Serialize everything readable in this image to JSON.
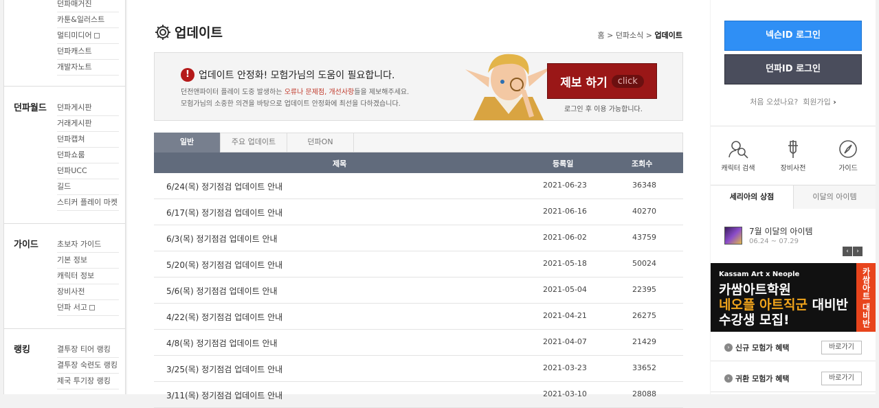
{
  "left_nav": {
    "top_items": [
      "던파매거진",
      "카툰&일러스트",
      "멀티미디어",
      "던파캐스트",
      "개발자노트"
    ],
    "sections": [
      {
        "title": "던파월드",
        "items": [
          "던파게시판",
          "거래게시판",
          "던파캡쳐",
          "던파쇼룸",
          "던파UCC",
          "길드",
          "스티커 플레이 마켓"
        ]
      },
      {
        "title": "가이드",
        "items": [
          "초보자 가이드",
          "기본 정보",
          "캐릭터 정보",
          "장비사전",
          "던파 서고"
        ]
      },
      {
        "title": "랭킹",
        "items": [
          "결투장 티어 랭킹",
          "결투장 숙련도 랭킹",
          "제국 투기장 랭킹"
        ]
      }
    ]
  },
  "page": {
    "title": "업데이트",
    "breadcrumb": {
      "home": "홈",
      "sep": ">",
      "section": "던파소식",
      "current": "업데이트"
    }
  },
  "banner": {
    "alert_icon": "!",
    "headline": "업데이트 안정화! 모험가님의 도움이 필요합니다.",
    "line1_pre": "던전앤파이터 플레이 도중 발생하는 ",
    "line1_red": "오류나 문제점, 개선사항",
    "line1_post": "들을 제보해주세요.",
    "line2": "모험가님의 소중한 의견을 바탕으로 업데이트 안정화에 최선을 다하겠습니다.",
    "button_label": "제보 하기",
    "button_sub": "click",
    "login_note": "로그인 후 이용 가능합니다."
  },
  "tabs": [
    "일반",
    "주요 업데이트",
    "던파ON"
  ],
  "table": {
    "headers": {
      "title": "제목",
      "date": "등록일",
      "views": "조회수"
    },
    "rows": [
      {
        "title": "6/24(목) 정기점검 업데이트 안내",
        "date": "2021-06-23",
        "views": "36348"
      },
      {
        "title": "6/17(목) 정기점검 업데이트 안내",
        "date": "2021-06-16",
        "views": "40270"
      },
      {
        "title": "6/3(목) 정기점검 업데이트 안내",
        "date": "2021-06-02",
        "views": "43759"
      },
      {
        "title": "5/20(목) 정기점검 업데이트 안내",
        "date": "2021-05-18",
        "views": "50024"
      },
      {
        "title": "5/6(목) 정기점검 업데이트 안내",
        "date": "2021-05-04",
        "views": "22395"
      },
      {
        "title": "4/22(목) 정기점검 업데이트 안내",
        "date": "2021-04-21",
        "views": "26275"
      },
      {
        "title": "4/8(목) 정기점검 업데이트 안내",
        "date": "2021-04-07",
        "views": "21429"
      },
      {
        "title": "3/25(목) 정기점검 업데이트 안내",
        "date": "2021-03-23",
        "views": "33652"
      },
      {
        "title": "3/11(목) 정기점검 업데이트 안내",
        "date": "2021-03-10",
        "views": "28088"
      }
    ]
  },
  "sidebar": {
    "nexon_login": "넥슨ID 로그인",
    "dnf_login": "던파ID 로그인",
    "join_prompt": "처음 오셨나요?",
    "join_link": "회원가입",
    "quick": [
      {
        "label": "캐릭터 검색",
        "icon": "character-search-icon"
      },
      {
        "label": "장비사전",
        "icon": "sword-icon"
      },
      {
        "label": "가이드",
        "icon": "compass-icon"
      }
    ],
    "shop_tabs": [
      "세리아의 상점",
      "이달의 아이템"
    ],
    "item_name": "7월 이달의 아이템",
    "item_period": "06.24 ~ 07.29",
    "prev_icon": "‹",
    "next_icon": "›",
    "ad": {
      "line1": "Kassam Art x Neople",
      "line2": "카쌈아트학원",
      "line3_orange": "네오플 아트직군",
      "line3_rest": " 대비반",
      "line4": "수강생 모집!",
      "band": "카쌈아트 대비반"
    },
    "benefits": [
      {
        "label": "신규 모험가 혜택",
        "button": "바로가기"
      },
      {
        "label": "귀환 모험가 혜택",
        "button": "바로가기"
      }
    ]
  }
}
